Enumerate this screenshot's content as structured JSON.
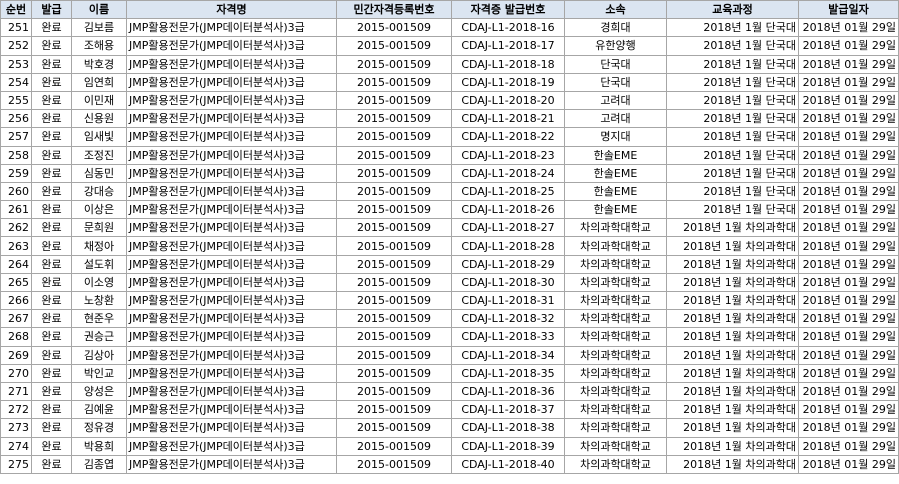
{
  "headers": [
    "순번",
    "발급",
    "이름",
    "자격명",
    "민간자격등록번호",
    "자격증 발급번호",
    "소속",
    "교육과정",
    "발급일자"
  ],
  "rows": [
    [
      "251",
      "완료",
      "김보름",
      "JMP활용전문가(JMP데이터분석사)3급",
      "2015-001509",
      "CDAJ-L1-2018-16",
      "경희대",
      "2018년 1월 단국대",
      "2018년 01월 29일"
    ],
    [
      "252",
      "완료",
      "조해용",
      "JMP활용전문가(JMP데이터분석사)3급",
      "2015-001509",
      "CDAJ-L1-2018-17",
      "유한양행",
      "2018년 1월 단국대",
      "2018년 01월 29일"
    ],
    [
      "253",
      "완료",
      "박호경",
      "JMP활용전문가(JMP데이터분석사)3급",
      "2015-001509",
      "CDAJ-L1-2018-18",
      "단국대",
      "2018년 1월 단국대",
      "2018년 01월 29일"
    ],
    [
      "254",
      "완료",
      "임연희",
      "JMP활용전문가(JMP데이터분석사)3급",
      "2015-001509",
      "CDAJ-L1-2018-19",
      "단국대",
      "2018년 1월 단국대",
      "2018년 01월 29일"
    ],
    [
      "255",
      "완료",
      "이민재",
      "JMP활용전문가(JMP데이터분석사)3급",
      "2015-001509",
      "CDAJ-L1-2018-20",
      "고려대",
      "2018년 1월 단국대",
      "2018년 01월 29일"
    ],
    [
      "256",
      "완료",
      "신용원",
      "JMP활용전문가(JMP데이터분석사)3급",
      "2015-001509",
      "CDAJ-L1-2018-21",
      "고려대",
      "2018년 1월 단국대",
      "2018년 01월 29일"
    ],
    [
      "257",
      "완료",
      "임새빛",
      "JMP활용전문가(JMP데이터분석사)3급",
      "2015-001509",
      "CDAJ-L1-2018-22",
      "명지대",
      "2018년 1월 단국대",
      "2018년 01월 29일"
    ],
    [
      "258",
      "완료",
      "조정진",
      "JMP활용전문가(JMP데이터분석사)3급",
      "2015-001509",
      "CDAJ-L1-2018-23",
      "한솔EME",
      "2018년 1월 단국대",
      "2018년 01월 29일"
    ],
    [
      "259",
      "완료",
      "심동민",
      "JMP활용전문가(JMP데이터분석사)3급",
      "2015-001509",
      "CDAJ-L1-2018-24",
      "한솔EME",
      "2018년 1월 단국대",
      "2018년 01월 29일"
    ],
    [
      "260",
      "완료",
      "강대승",
      "JMP활용전문가(JMP데이터분석사)3급",
      "2015-001509",
      "CDAJ-L1-2018-25",
      "한솔EME",
      "2018년 1월 단국대",
      "2018년 01월 29일"
    ],
    [
      "261",
      "완료",
      "이상은",
      "JMP활용전문가(JMP데이터분석사)3급",
      "2015-001509",
      "CDAJ-L1-2018-26",
      "한솔EME",
      "2018년 1월 단국대",
      "2018년 01월 29일"
    ],
    [
      "262",
      "완료",
      "문희원",
      "JMP활용전문가(JMP데이터분석사)3급",
      "2015-001509",
      "CDAJ-L1-2018-27",
      "차의과학대학교",
      "2018년 1월 차의과학대",
      "2018년 01월 29일"
    ],
    [
      "263",
      "완료",
      "채정아",
      "JMP활용전문가(JMP데이터분석사)3급",
      "2015-001509",
      "CDAJ-L1-2018-28",
      "차의과학대학교",
      "2018년 1월 차의과학대",
      "2018년 01월 29일"
    ],
    [
      "264",
      "완료",
      "설도휘",
      "JMP활용전문가(JMP데이터분석사)3급",
      "2015-001509",
      "CDAJ-L1-2018-29",
      "차의과학대학교",
      "2018년 1월 차의과학대",
      "2018년 01월 29일"
    ],
    [
      "265",
      "완료",
      "이소영",
      "JMP활용전문가(JMP데이터분석사)3급",
      "2015-001509",
      "CDAJ-L1-2018-30",
      "차의과학대학교",
      "2018년 1월 차의과학대",
      "2018년 01월 29일"
    ],
    [
      "266",
      "완료",
      "노창환",
      "JMP활용전문가(JMP데이터분석사)3급",
      "2015-001509",
      "CDAJ-L1-2018-31",
      "차의과학대학교",
      "2018년 1월 차의과학대",
      "2018년 01월 29일"
    ],
    [
      "267",
      "완료",
      "현준우",
      "JMP활용전문가(JMP데이터분석사)3급",
      "2015-001509",
      "CDAJ-L1-2018-32",
      "차의과학대학교",
      "2018년 1월 차의과학대",
      "2018년 01월 29일"
    ],
    [
      "268",
      "완료",
      "권승근",
      "JMP활용전문가(JMP데이터분석사)3급",
      "2015-001509",
      "CDAJ-L1-2018-33",
      "차의과학대학교",
      "2018년 1월 차의과학대",
      "2018년 01월 29일"
    ],
    [
      "269",
      "완료",
      "김상아",
      "JMP활용전문가(JMP데이터분석사)3급",
      "2015-001509",
      "CDAJ-L1-2018-34",
      "차의과학대학교",
      "2018년 1월 차의과학대",
      "2018년 01월 29일"
    ],
    [
      "270",
      "완료",
      "박인교",
      "JMP활용전문가(JMP데이터분석사)3급",
      "2015-001509",
      "CDAJ-L1-2018-35",
      "차의과학대학교",
      "2018년 1월 차의과학대",
      "2018년 01월 29일"
    ],
    [
      "271",
      "완료",
      "양성은",
      "JMP활용전문가(JMP데이터분석사)3급",
      "2015-001509",
      "CDAJ-L1-2018-36",
      "차의과학대학교",
      "2018년 1월 차의과학대",
      "2018년 01월 29일"
    ],
    [
      "272",
      "완료",
      "김예윤",
      "JMP활용전문가(JMP데이터분석사)3급",
      "2015-001509",
      "CDAJ-L1-2018-37",
      "차의과학대학교",
      "2018년 1월 차의과학대",
      "2018년 01월 29일"
    ],
    [
      "273",
      "완료",
      "정유경",
      "JMP활용전문가(JMP데이터분석사)3급",
      "2015-001509",
      "CDAJ-L1-2018-38",
      "차의과학대학교",
      "2018년 1월 차의과학대",
      "2018년 01월 29일"
    ],
    [
      "274",
      "완료",
      "박용희",
      "JMP활용전문가(JMP데이터분석사)3급",
      "2015-001509",
      "CDAJ-L1-2018-39",
      "차의과학대학교",
      "2018년 1월 차의과학대",
      "2018년 01월 29일"
    ],
    [
      "275",
      "완료",
      "김종엽",
      "JMP활용전문가(JMP데이터분석사)3급",
      "2015-001509",
      "CDAJ-L1-2018-40",
      "차의과학대학교",
      "2018년 1월 차의과학대",
      "2018년 01월 29일"
    ]
  ]
}
